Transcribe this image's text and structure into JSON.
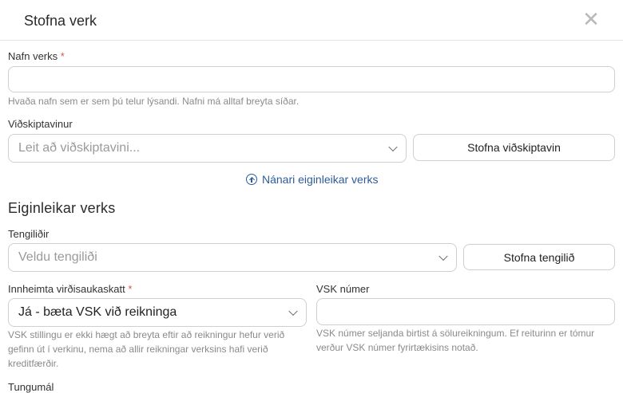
{
  "modal": {
    "title": "Stofna verk",
    "close_glyph": "✕"
  },
  "project_name": {
    "label": "Nafn verks",
    "required_mark": "*",
    "value": "",
    "help": "Hvaða nafn sem er sem þú telur lýsandi. Nafni má alltaf breyta síðar."
  },
  "customer": {
    "label": "Viðskiptavinur",
    "placeholder": "Leit að viðskiptavini...",
    "create_button": "Stofna viðskiptavin"
  },
  "more_properties_link": "Nánari eiginleikar verks",
  "properties": {
    "title": "Eiginleikar verks",
    "contacts": {
      "label": "Tengiliðir",
      "placeholder": "Veldu tengiliði",
      "create_button": "Stofna tengilið"
    },
    "vat_charge": {
      "label": "Innheimta virðisaukaskatt",
      "required_mark": "*",
      "selected": "Já - bæta VSK við reikninga",
      "help": "VSK stillingu er ekki hægt að breyta eftir að reikningur hefur verið gefinn út í verkinu, nema að allir reikningar verksins hafi verið kreditfærðir."
    },
    "vat_number": {
      "label": "VSK númer",
      "value": "",
      "help": "VSK númer seljanda birtist á sölureikningum. Ef reiturinn er tómur verður VSK númer fyrirtækisins notað."
    },
    "language": {
      "label": "Tungumál"
    }
  },
  "icons": {
    "close": "close-icon",
    "chevron": "chevron-down-icon",
    "circle_up": "circle-arrow-up-icon"
  }
}
